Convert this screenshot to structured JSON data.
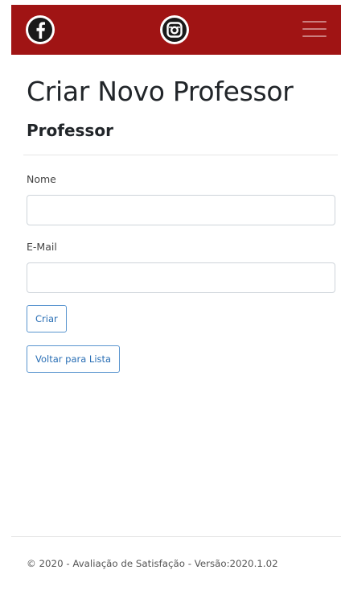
{
  "navbar": {
    "background": "#a01414",
    "facebook_icon": "facebook-icon",
    "instagram_icon": "instagram-icon",
    "menu_icon": "hamburger-menu-icon"
  },
  "page": {
    "title": "Criar Novo Professor",
    "section": "Professor"
  },
  "form": {
    "nome_label": "Nome",
    "nome_value": "",
    "email_label": "E-Mail",
    "email_value": "",
    "submit_label": "Criar"
  },
  "links": {
    "back_label": "Voltar para Lista"
  },
  "footer": {
    "text": "© 2020 - Avaliação de Satisfação - Versão:2020.1.02"
  },
  "colors": {
    "accent": "#2a6fb5",
    "navbar": "#a01414"
  }
}
